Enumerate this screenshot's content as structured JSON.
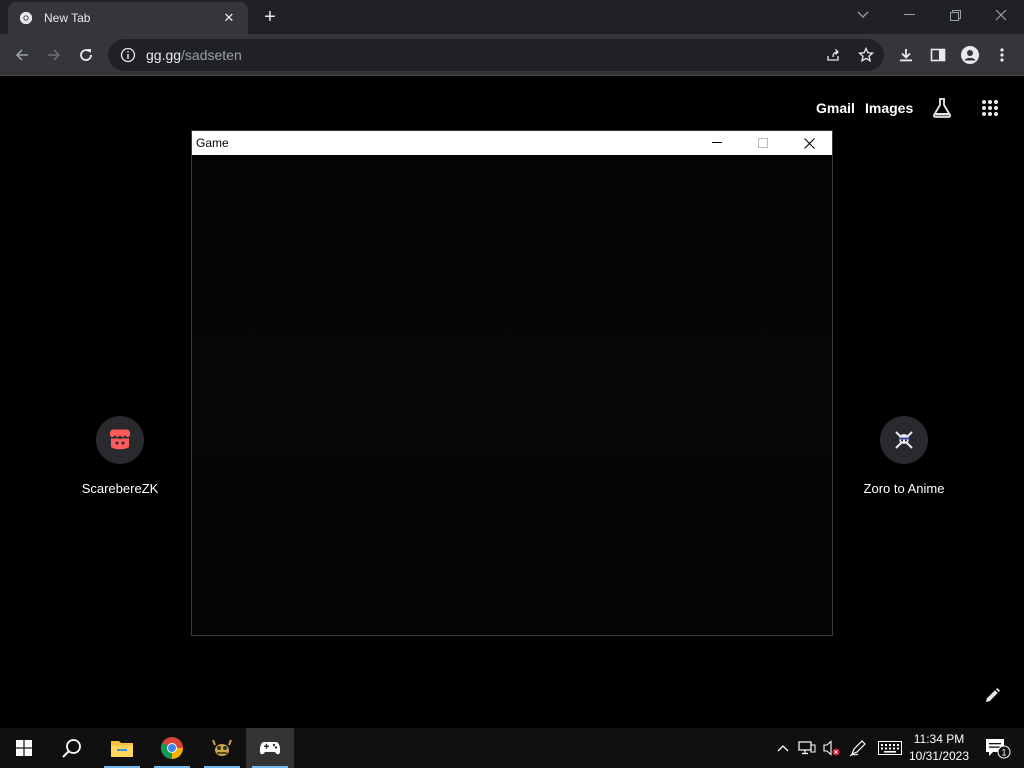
{
  "browser": {
    "tab": {
      "title": "New Tab",
      "close": "✕"
    },
    "new_tab": "+",
    "url": {
      "host": "gg.gg",
      "path": "/sadseten"
    }
  },
  "ntp": {
    "links": [
      "Gmail",
      "Images"
    ],
    "shortcuts": [
      {
        "label": "ScarebereZK",
        "icon": "itch-io-icon"
      },
      {
        "label": "Zoro to Anime",
        "icon": "zoro-skull-icon"
      }
    ]
  },
  "game_window": {
    "title": "Game"
  },
  "taskbar": {
    "apps": [
      "start",
      "search",
      "file-explorer",
      "chrome",
      "game-app",
      "game-controller"
    ],
    "clock": {
      "time": "11:34 PM",
      "date": "10/31/2023"
    },
    "notification_count": "1"
  },
  "colors": {
    "tabstrip": "#202124",
    "toolbar": "#35363a",
    "page_bg": "#000000",
    "taskbar": "#101010",
    "accent": "#76b9ed"
  }
}
